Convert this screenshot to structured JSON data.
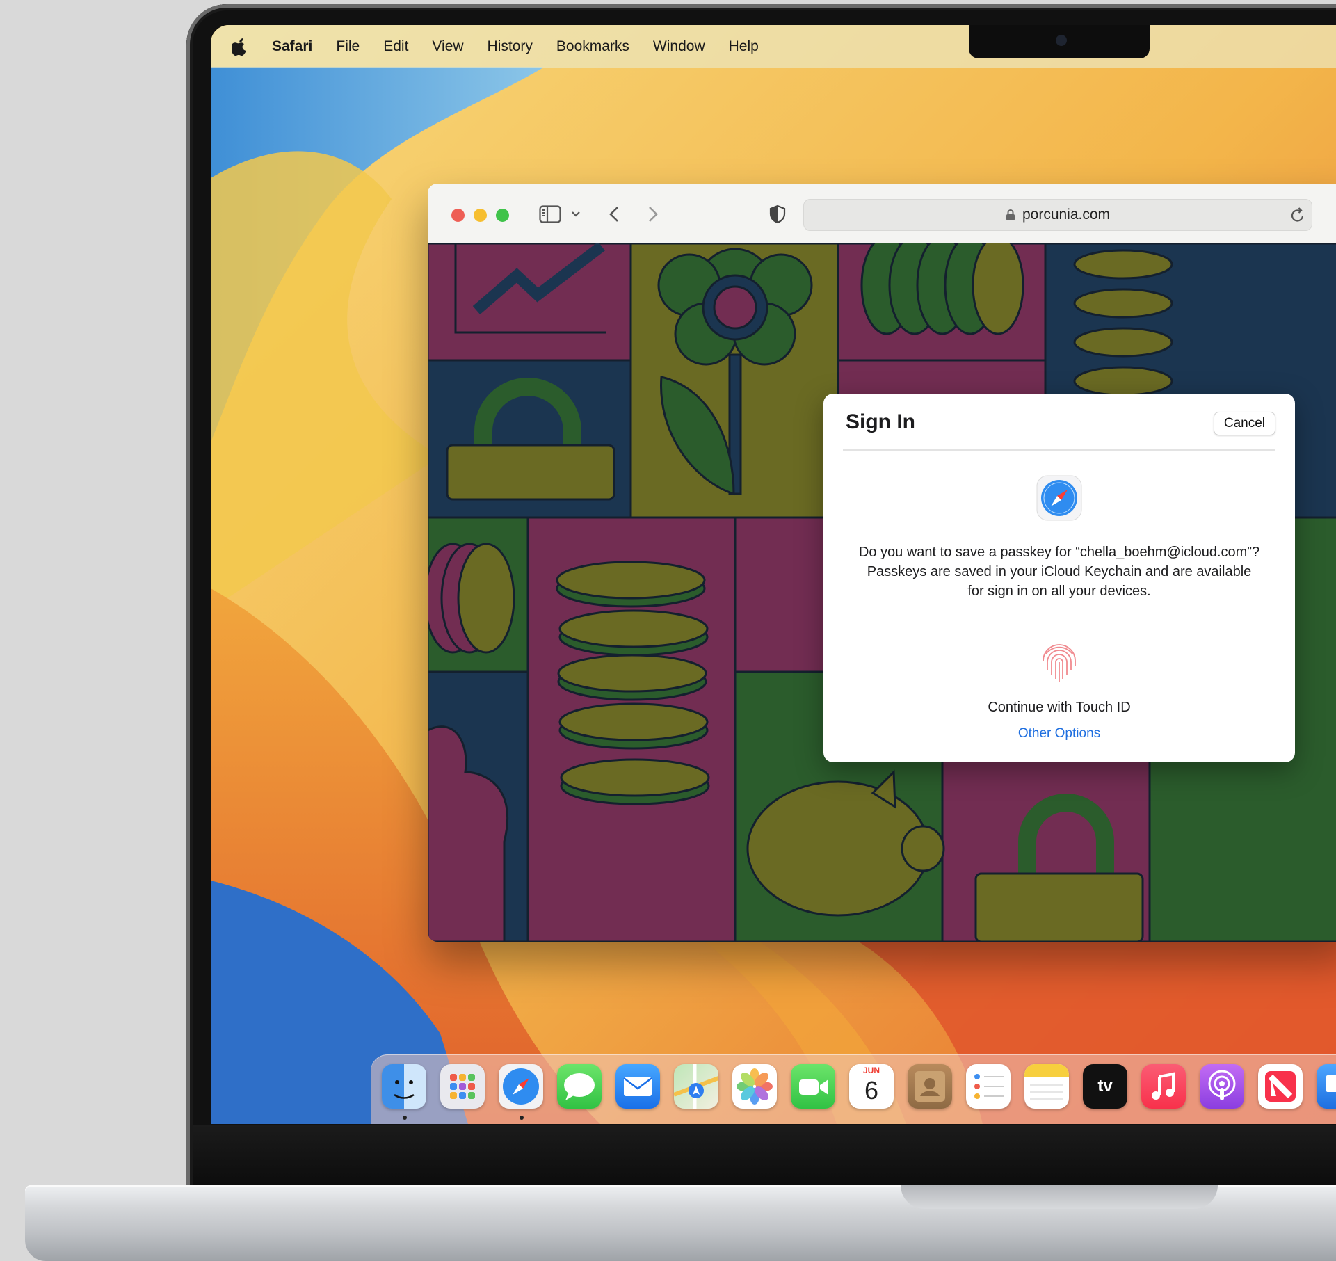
{
  "menubar": {
    "app_name": "Safari",
    "items": [
      "File",
      "Edit",
      "View",
      "History",
      "Bookmarks",
      "Window",
      "Help"
    ]
  },
  "browser": {
    "url": "porcunia.com"
  },
  "dialog": {
    "title": "Sign In",
    "cancel_label": "Cancel",
    "message": "Do you want to save a passkey for “chella_boehm@icloud.com”? Passkeys are saved in your iCloud Keychain and are available for sign in on all your devices.",
    "touch_id_label": "Continue with Touch ID",
    "other_options_label": "Other Options"
  },
  "dock": {
    "calendar_month": "JUN",
    "calendar_day": "6",
    "tv_label": "tv",
    "apps": [
      "finder",
      "launchpad",
      "safari",
      "messages",
      "mail",
      "maps",
      "photos",
      "facetime",
      "calendar",
      "contacts",
      "reminders",
      "notes",
      "tv",
      "music",
      "podcasts",
      "news",
      "keynote"
    ],
    "running": [
      "finder",
      "safari"
    ]
  },
  "colors": {
    "accent_link": "#1f6fe0",
    "close": "#ee5e55",
    "minimize": "#f6be2f",
    "zoom": "#3fc34a"
  }
}
